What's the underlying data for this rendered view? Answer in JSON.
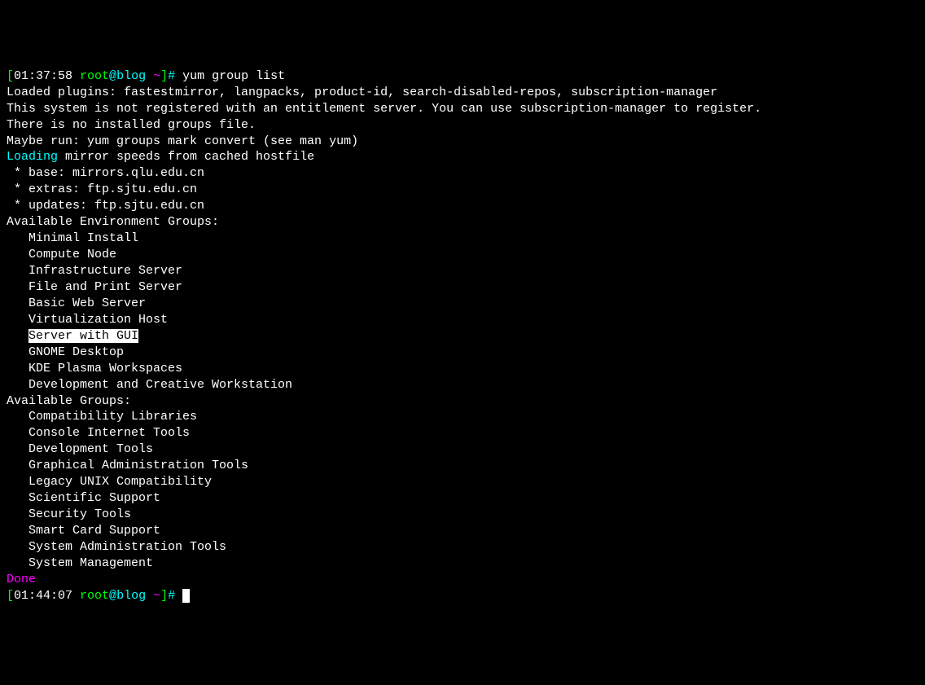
{
  "prompt1": {
    "bracket_open": "[",
    "time": "01:37:58",
    "user": " root",
    "at": "@",
    "host": "blog ",
    "tilde": "~",
    "bracket_close": "]",
    "hash": "# ",
    "command": "yum group list"
  },
  "lines": {
    "loaded_plugins": "Loaded plugins: fastestmirror, langpacks, product-id, search-disabled-repos, subscription-manager",
    "blank1": "",
    "not_registered": "This system is not registered with an entitlement server. You can use subscription-manager to register.",
    "blank2": "",
    "no_groups_file": "There is no installed groups file.",
    "maybe_run": "Maybe run: yum groups mark convert (see man yum)",
    "loading_word": "Loading",
    "loading_rest": " mirror speeds from cached hostfile",
    "mirror_base": " * base: mirrors.qlu.edu.cn",
    "mirror_extras": " * extras: ftp.sjtu.edu.cn",
    "mirror_updates": " * updates: ftp.sjtu.edu.cn",
    "env_groups_header": "Available Environment Groups:",
    "env_groups": [
      "   Minimal Install",
      "   Compute Node",
      "   Infrastructure Server",
      "   File and Print Server",
      "   Basic Web Server",
      "   Virtualization Host"
    ],
    "env_group_highlighted_prefix": "   ",
    "env_group_highlighted": "Server with GUI",
    "env_groups_after": [
      "   GNOME Desktop",
      "   KDE Plasma Workspaces",
      "   Development and Creative Workstation"
    ],
    "avail_groups_header": "Available Groups:",
    "avail_groups": [
      "   Compatibility Libraries",
      "   Console Internet Tools",
      "   Development Tools",
      "   Graphical Administration Tools",
      "   Legacy UNIX Compatibility",
      "   Scientific Support",
      "   Security Tools",
      "   Smart Card Support",
      "   System Administration Tools",
      "   System Management"
    ],
    "done": "Done"
  },
  "prompt2": {
    "bracket_open": "[",
    "time": "01:44:07",
    "user": " root",
    "at": "@",
    "host": "blog ",
    "tilde": "~",
    "bracket_close": "]",
    "hash": "# "
  }
}
